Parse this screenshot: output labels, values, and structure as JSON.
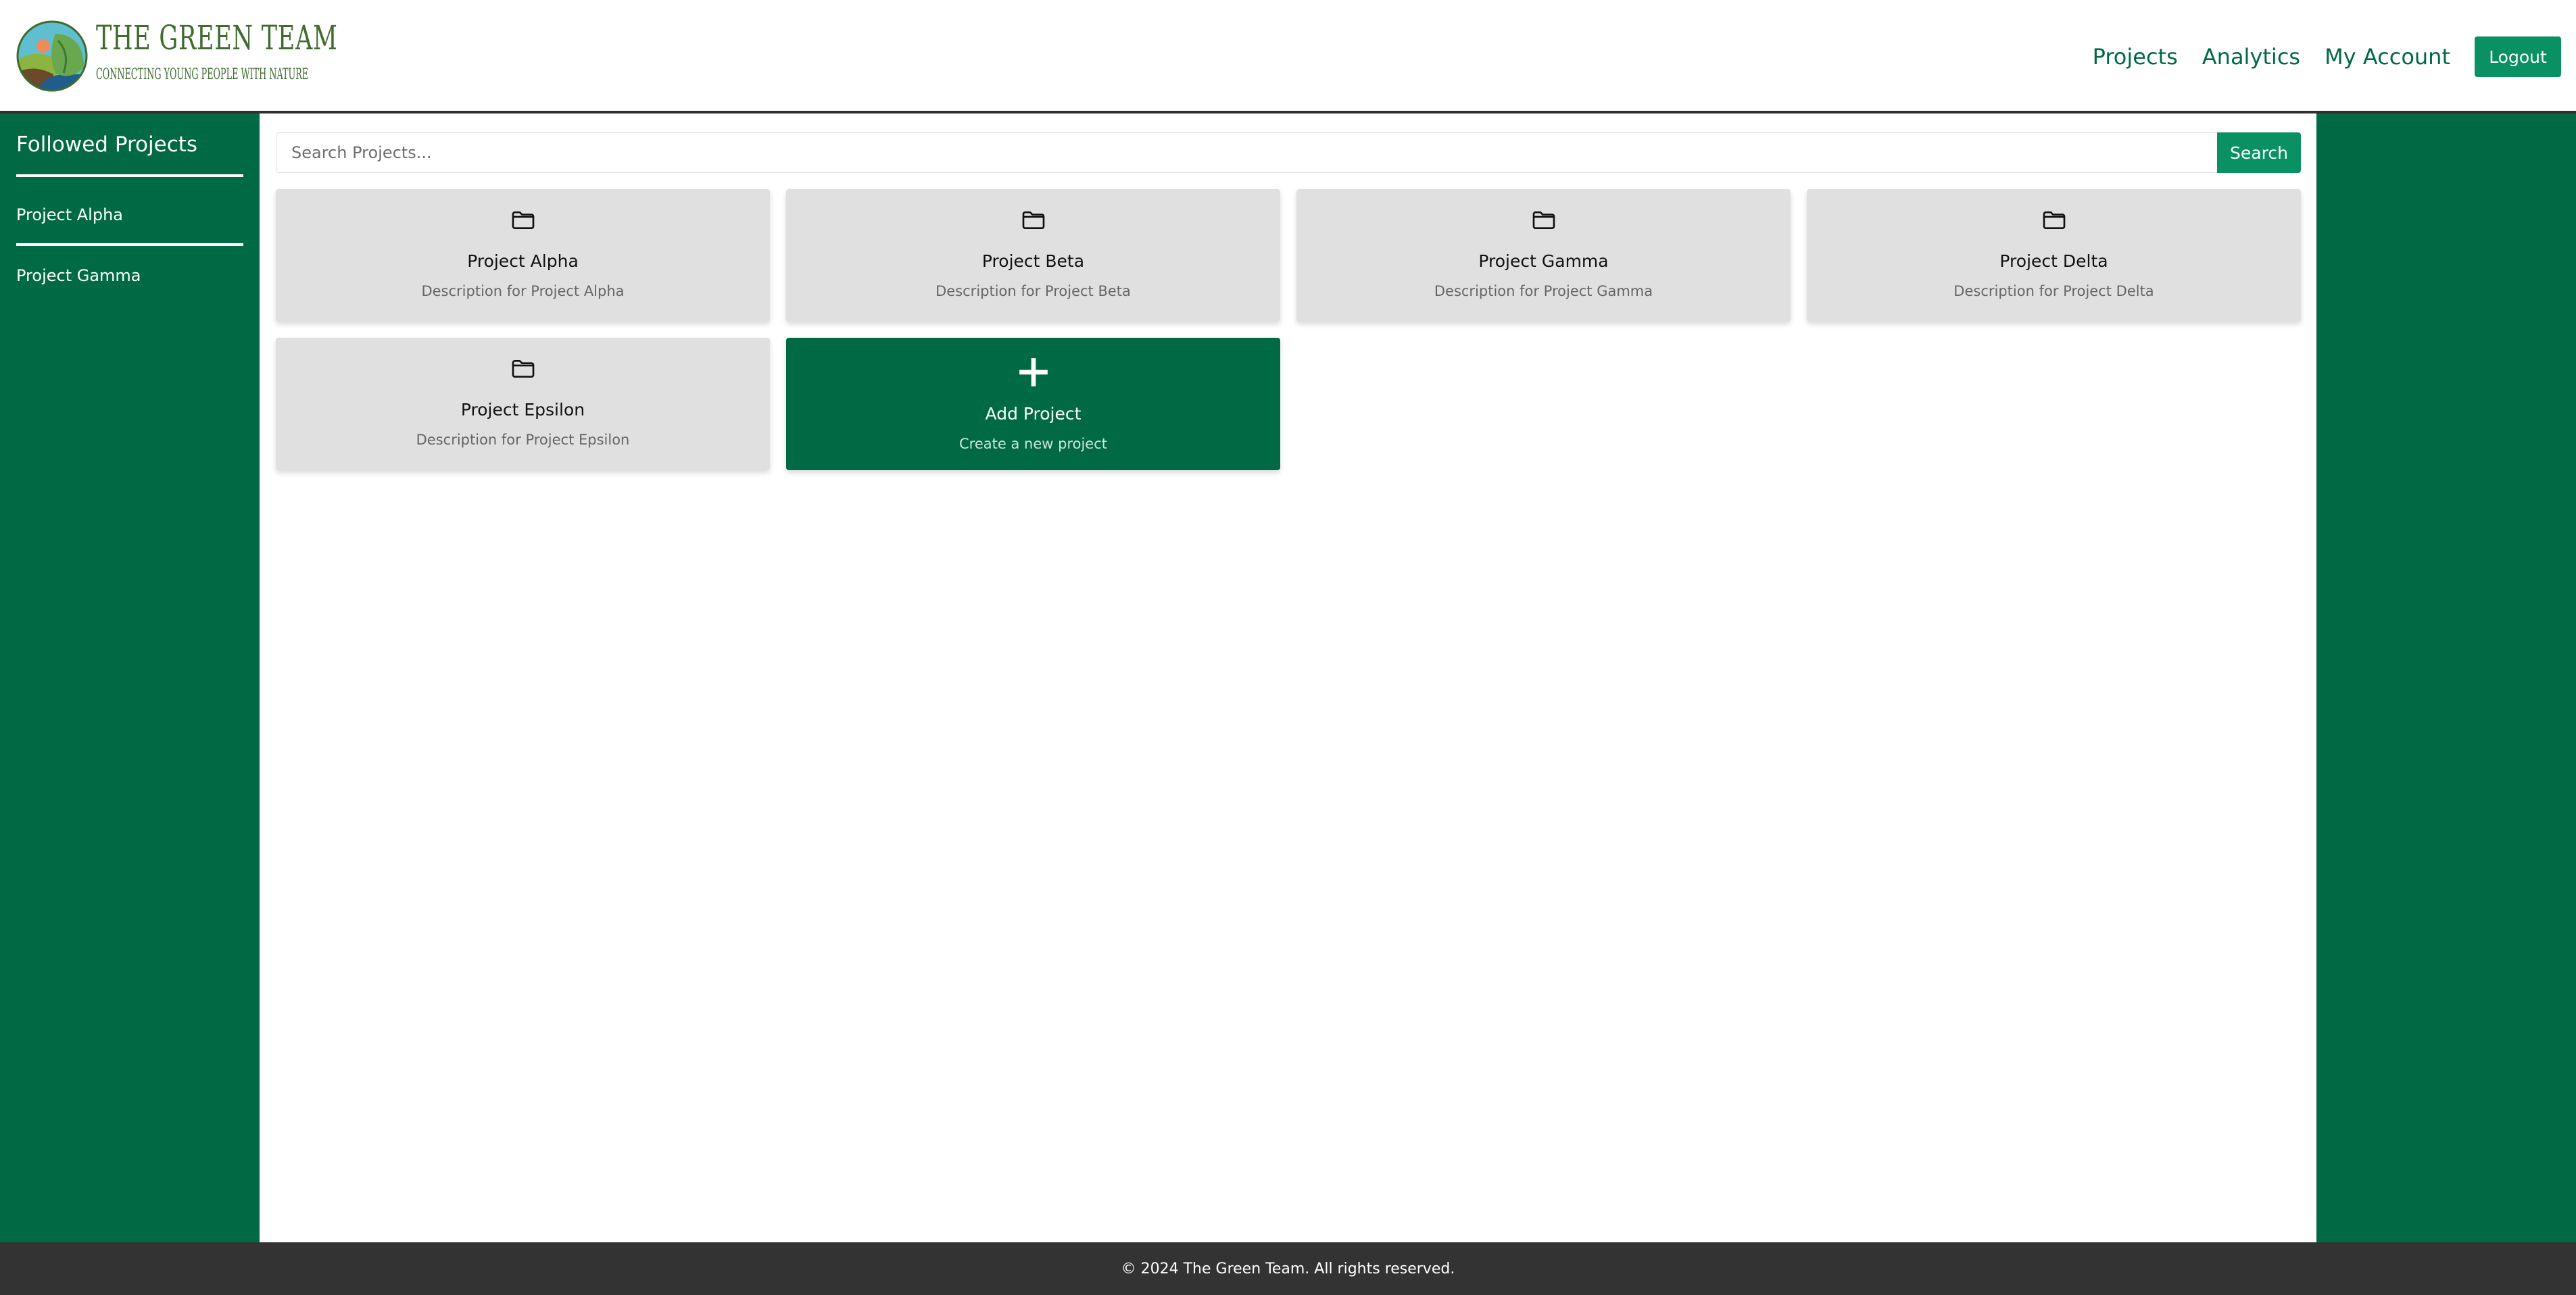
{
  "header": {
    "logo_title": "THE GREEN TEAM",
    "logo_subtitle": "CONNECTING YOUNG PEOPLE WITH NATURE",
    "nav": [
      "Projects",
      "Analytics",
      "My Account"
    ],
    "logout_label": "Logout"
  },
  "sidebar": {
    "title": "Followed Projects",
    "items": [
      "Project Alpha",
      "Project Gamma"
    ]
  },
  "search": {
    "placeholder": "Search Projects...",
    "button_label": "Search"
  },
  "projects": [
    {
      "title": "Project Alpha",
      "desc": "Description for Project Alpha",
      "icon": "folder-icon"
    },
    {
      "title": "Project Beta",
      "desc": "Description for Project Beta",
      "icon": "folder-icon"
    },
    {
      "title": "Project Gamma",
      "desc": "Description for Project Gamma",
      "icon": "folder-icon"
    },
    {
      "title": "Project Delta",
      "desc": "Description for Project Delta",
      "icon": "folder-icon"
    },
    {
      "title": "Project Epsilon",
      "desc": "Description for Project Epsilon",
      "icon": "folder-icon"
    }
  ],
  "add_card": {
    "title": "Add Project",
    "desc": "Create a new project",
    "icon": "plus-icon"
  },
  "footer": {
    "text": "© 2024 The Green Team. All rights reserved."
  },
  "colors": {
    "primary": "#006a44",
    "accent": "#099163",
    "card_bg": "#e0e0e0",
    "footer_bg": "#333333"
  }
}
